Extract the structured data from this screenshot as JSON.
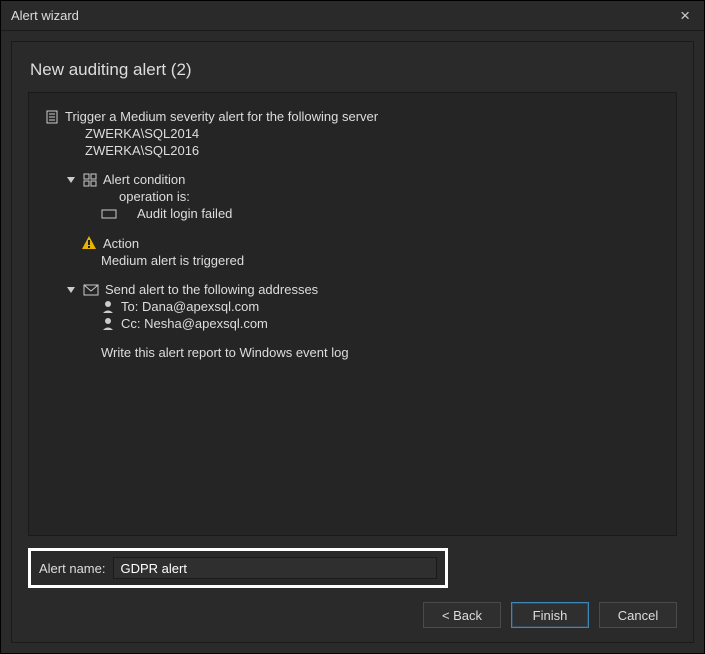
{
  "window": {
    "title": "Alert wizard",
    "subtitle": "New auditing alert (2)"
  },
  "summary": {
    "trigger_line": "Trigger a Medium severity alert for the following server",
    "servers": [
      "ZWERKA\\SQL2014",
      "ZWERKA\\SQL2016"
    ],
    "condition_header": "Alert condition",
    "condition_op": "operation is:",
    "condition_value": "Audit login failed",
    "action_header": "Action",
    "action_text": "Medium alert is triggered",
    "send_header": "Send alert to the following addresses",
    "recipients": {
      "to_label": "To: ",
      "to_value": "Dana@apexsql.com",
      "cc_label": "Cc: ",
      "cc_value": "Nesha@apexsql.com"
    },
    "event_log": "Write this alert report to Windows event log"
  },
  "alert_name": {
    "label": "Alert name:",
    "value": "GDPR alert"
  },
  "buttons": {
    "back": "< Back",
    "finish": "Finish",
    "cancel": "Cancel"
  }
}
